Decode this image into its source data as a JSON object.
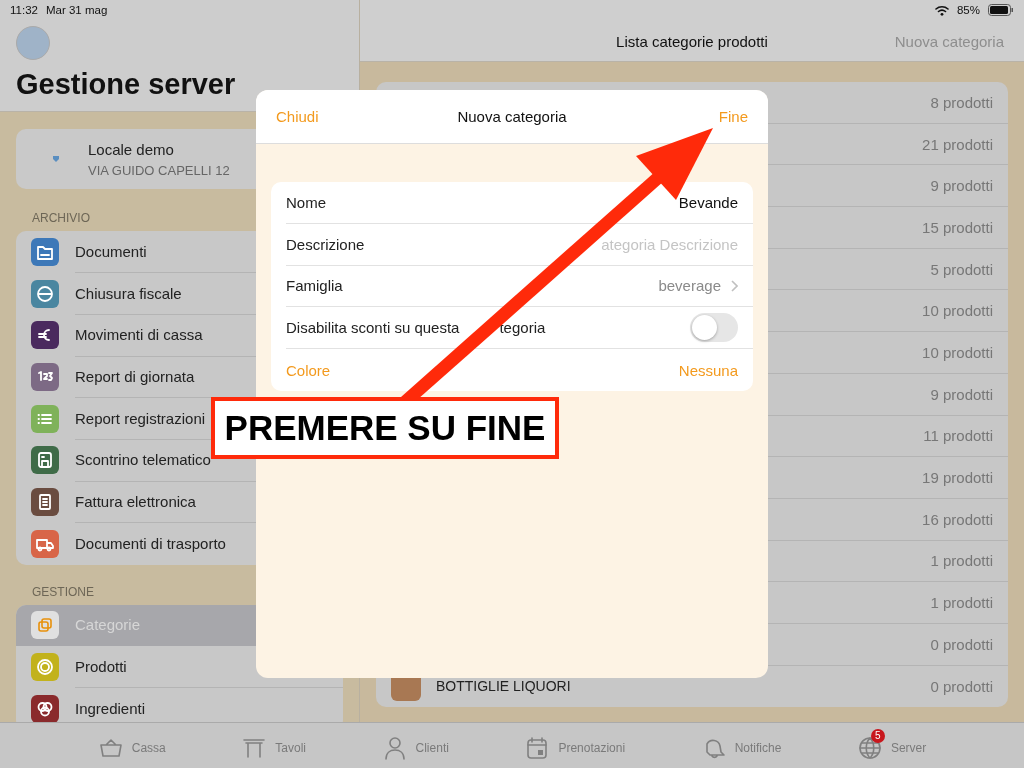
{
  "status_bar": {
    "time": "11:32",
    "date": "Mar 31 mag",
    "battery": "85%"
  },
  "sidebar": {
    "title": "Gestione server",
    "venue": {
      "name": "Locale demo",
      "address": "VIA GUIDO CAPELLI 12"
    },
    "sections": [
      {
        "title": "ARCHIVIO",
        "items": [
          {
            "label": "Documenti",
            "color": "#3d78b8",
            "selected": false
          },
          {
            "label": "Chiusura fiscale",
            "color": "#4a86a0",
            "selected": false
          },
          {
            "label": "Movimenti di cassa",
            "color": "#4a2a5e",
            "selected": false
          },
          {
            "label": "Report di giornata",
            "color": "#7d6a85",
            "selected": false
          },
          {
            "label": "Report registrazioni",
            "color": "#7fb25a",
            "selected": false
          },
          {
            "label": "Scontrino telematico",
            "color": "#3f6b48",
            "selected": false
          },
          {
            "label": "Fattura elettronica",
            "color": "#6a4c40",
            "selected": false
          },
          {
            "label": "Documenti di trasporto",
            "color": "#d86548",
            "selected": false
          }
        ]
      },
      {
        "title": "GESTIONE",
        "items": [
          {
            "label": "Categorie",
            "color": "#e0e0e0",
            "selected": true
          },
          {
            "label": "Prodotti",
            "color": "#c2b21c",
            "selected": false
          },
          {
            "label": "Ingredienti",
            "color": "#8a2a2c",
            "selected": false
          }
        ]
      }
    ]
  },
  "main": {
    "title": "Lista categorie prodotti",
    "action": "Nuova categoria",
    "rows": [
      {
        "count": "8 prodotti"
      },
      {
        "count": "21 prodotti"
      },
      {
        "count": "9 prodotti"
      },
      {
        "count": "15 prodotti"
      },
      {
        "count": "5 prodotti"
      },
      {
        "count": "10 prodotti"
      },
      {
        "count": "10 prodotti"
      },
      {
        "count": "9 prodotti"
      },
      {
        "count": "11 prodotti"
      },
      {
        "count": "19 prodotti"
      },
      {
        "count": "16 prodotti"
      },
      {
        "count": "1 prodotti"
      },
      {
        "count": "1 prodotti"
      },
      {
        "count": "0 prodotti"
      },
      {
        "name": "BOTTIGLIE LIQUORI",
        "color": "#a87853",
        "count": "0 prodotti"
      }
    ]
  },
  "modal": {
    "cancel": "Chiudi",
    "title": "Nuova categoria",
    "done": "Fine",
    "fields": [
      {
        "kind": "text",
        "label": "Nome",
        "value": "Bevande"
      },
      {
        "kind": "text",
        "label": "Descrizione",
        "placeholder": "ategoria Descrizione"
      },
      {
        "kind": "link",
        "label": "Famiglia",
        "value": "beverage"
      },
      {
        "kind": "toggle",
        "label": "Disabilita sconti su questa",
        "label_tail": "tegoria",
        "on": false
      },
      {
        "kind": "option",
        "label": "Colore",
        "value": "Nessuna"
      }
    ]
  },
  "tab_bar": [
    {
      "label": "Cassa"
    },
    {
      "label": "Tavoli"
    },
    {
      "label": "Clienti"
    },
    {
      "label": "Prenotazioni"
    },
    {
      "label": "Notifiche"
    },
    {
      "label": "Server",
      "badge": "5"
    }
  ],
  "annotation": {
    "text": "PREMERE SU FINE"
  }
}
